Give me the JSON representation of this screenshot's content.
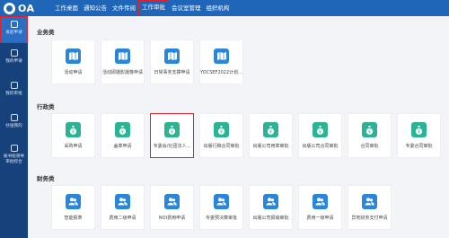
{
  "app": {
    "logo_text": "OA"
  },
  "nav": {
    "items": [
      {
        "label": "工作桌面",
        "active": false
      },
      {
        "label": "通知公告",
        "active": false
      },
      {
        "label": "文件传阅",
        "active": false
      },
      {
        "label": "工作审批",
        "active": true
      },
      {
        "label": "会议室管理",
        "active": false
      },
      {
        "label": "组织机构",
        "active": false
      }
    ]
  },
  "sidebar": {
    "items": [
      {
        "label": "发起申请",
        "icon": "document-edit-icon",
        "active": true
      },
      {
        "label": "我的申请",
        "icon": "document-icon",
        "active": false
      },
      {
        "label": "我的审批",
        "icon": "approval-icon",
        "active": false
      },
      {
        "label": "抄送我的",
        "icon": "cc-user-icon",
        "active": false
      },
      {
        "label": "秘书给领导",
        "label2": "审批综合",
        "icon": "secretary-icon",
        "active": false
      }
    ]
  },
  "sections": [
    {
      "title": "业务类",
      "items": [
        {
          "label": "活动申请",
          "icon": "map-icon",
          "color": "#2b86d9"
        },
        {
          "label": "活动即摄影摄像申请",
          "icon": "map-icon",
          "color": "#2b86d9"
        },
        {
          "label": "日常事务支撑申请",
          "icon": "map-icon",
          "color": "#2b86d9"
        },
        {
          "label": "YOCSEF2022计划...",
          "icon": "map-icon",
          "color": "#2b86d9"
        }
      ]
    },
    {
      "title": "行政类",
      "items": [
        {
          "label": "采购申请",
          "icon": "money-bag-icon",
          "color": "#2bb394"
        },
        {
          "label": "盖章申请",
          "icon": "money-bag-icon",
          "color": "#2bb394"
        },
        {
          "label": "专委会/社团法人...",
          "icon": "money-bag-icon",
          "color": "#2bb394",
          "highlight": true
        },
        {
          "label": "出版行稿合同审批",
          "icon": "money-bag-icon",
          "color": "#2bb394"
        },
        {
          "label": "出版公司用章审批",
          "icon": "money-bag-icon",
          "color": "#2bb394"
        },
        {
          "label": "出版公司合同审批",
          "icon": "money-bag-icon",
          "color": "#2bb394"
        },
        {
          "label": "合同审批",
          "icon": "money-bag-icon",
          "color": "#2bb394"
        },
        {
          "label": "专委合同审批",
          "icon": "money-bag-icon",
          "color": "#2bb394"
        }
      ]
    },
    {
      "title": "财务类",
      "items": [
        {
          "label": "智能报表",
          "icon": "users-icon",
          "color": "#2b86d9"
        },
        {
          "label": "费用二级申请",
          "icon": "users-icon",
          "color": "#2b86d9"
        },
        {
          "label": "NOI费用申请",
          "icon": "users-icon",
          "color": "#2b86d9"
        },
        {
          "label": "专委预决算审批",
          "icon": "users-icon",
          "color": "#2b86d9"
        },
        {
          "label": "出版公司报销审批",
          "icon": "users-icon",
          "color": "#2b86d9"
        },
        {
          "label": "费用一级申请",
          "icon": "users-icon",
          "color": "#2b86d9"
        },
        {
          "label": "异地财务支付申请",
          "icon": "users-icon",
          "color": "#2b86d9"
        }
      ]
    }
  ]
}
